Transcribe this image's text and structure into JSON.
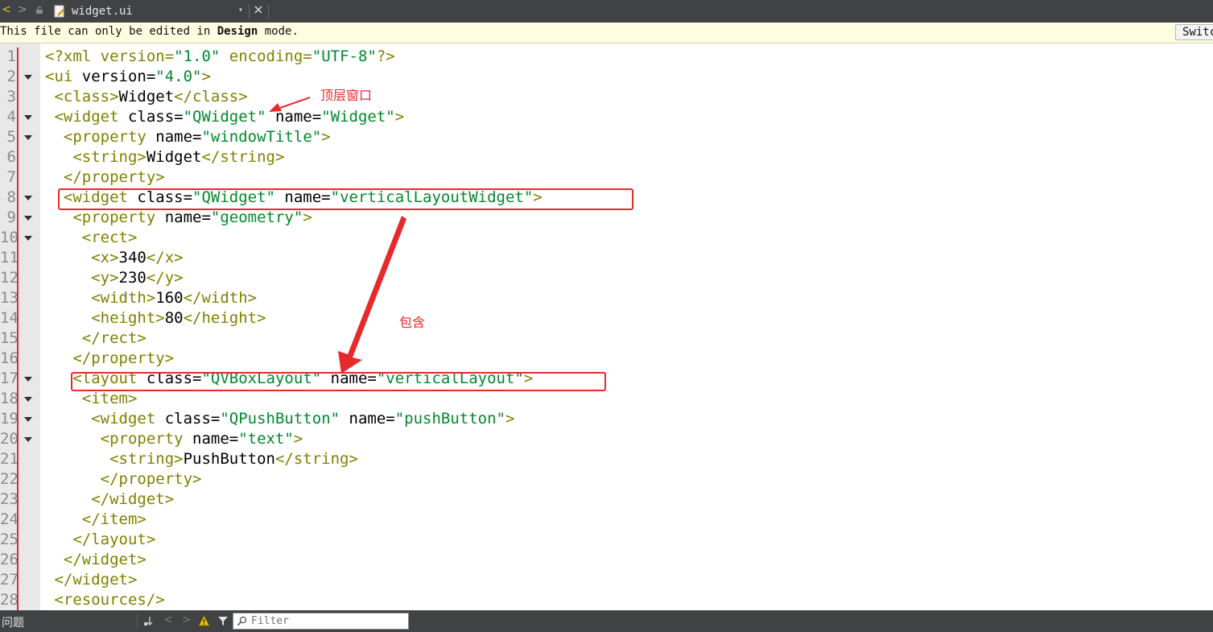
{
  "tab": {
    "back_glyph": "<",
    "forward_glyph": ">",
    "file_name": "widget.ui",
    "dropdown_glyph": "▾"
  },
  "infobar": {
    "text_before": "This file can only be edited in ",
    "text_bold": "Design",
    "text_after": " mode.",
    "switch_label": "Switch mode"
  },
  "editor": {
    "lines": [
      {
        "n": "1",
        "fold": false
      },
      {
        "n": "2",
        "fold": true
      },
      {
        "n": "3",
        "fold": false
      },
      {
        "n": "4",
        "fold": true
      },
      {
        "n": "5",
        "fold": true
      },
      {
        "n": "6",
        "fold": false
      },
      {
        "n": "7",
        "fold": false
      },
      {
        "n": "8",
        "fold": true
      },
      {
        "n": "9",
        "fold": true
      },
      {
        "n": "10",
        "fold": true
      },
      {
        "n": "11",
        "fold": false
      },
      {
        "n": "12",
        "fold": false
      },
      {
        "n": "13",
        "fold": false
      },
      {
        "n": "14",
        "fold": false
      },
      {
        "n": "15",
        "fold": false
      },
      {
        "n": "16",
        "fold": false
      },
      {
        "n": "17",
        "fold": true
      },
      {
        "n": "18",
        "fold": true
      },
      {
        "n": "19",
        "fold": true
      },
      {
        "n": "20",
        "fold": true
      },
      {
        "n": "21",
        "fold": false
      },
      {
        "n": "22",
        "fold": false
      },
      {
        "n": "23",
        "fold": false
      },
      {
        "n": "24",
        "fold": false
      },
      {
        "n": "25",
        "fold": false
      },
      {
        "n": "26",
        "fold": false
      },
      {
        "n": "27",
        "fold": false
      },
      {
        "n": "28",
        "fold": false
      }
    ],
    "code": [
      [
        [
          "t",
          "<?xml version="
        ],
        [
          "s",
          "\"1.0\""
        ],
        [
          "t",
          " encoding="
        ],
        [
          "s",
          "\"UTF-8\""
        ],
        [
          "t",
          "?>"
        ]
      ],
      [
        [
          "t",
          "<ui "
        ],
        [
          "d",
          "version="
        ],
        [
          "s",
          "\"4.0\""
        ],
        [
          "t",
          ">"
        ]
      ],
      [
        [
          "t",
          " <class>"
        ],
        [
          "d",
          "Widget"
        ],
        [
          "t",
          "</class>"
        ]
      ],
      [
        [
          "t",
          " <widget "
        ],
        [
          "d",
          "class="
        ],
        [
          "s",
          "\"QWidget\""
        ],
        [
          "d",
          " name="
        ],
        [
          "s",
          "\"Widget\""
        ],
        [
          "t",
          ">"
        ]
      ],
      [
        [
          "t",
          "  <property "
        ],
        [
          "d",
          "name="
        ],
        [
          "s",
          "\"windowTitle\""
        ],
        [
          "t",
          ">"
        ]
      ],
      [
        [
          "t",
          "   <string>"
        ],
        [
          "d",
          "Widget"
        ],
        [
          "t",
          "</string>"
        ]
      ],
      [
        [
          "t",
          "  </property>"
        ]
      ],
      [
        [
          "t",
          "  <widget "
        ],
        [
          "d",
          "class="
        ],
        [
          "s",
          "\"QWidget\""
        ],
        [
          "d",
          " name="
        ],
        [
          "s",
          "\"verticalLayoutWidget\""
        ],
        [
          "t",
          ">"
        ]
      ],
      [
        [
          "t",
          "   <property "
        ],
        [
          "d",
          "name="
        ],
        [
          "s",
          "\"geometry\""
        ],
        [
          "t",
          ">"
        ]
      ],
      [
        [
          "t",
          "    <rect>"
        ]
      ],
      [
        [
          "t",
          "     <x>"
        ],
        [
          "d",
          "340"
        ],
        [
          "t",
          "</x>"
        ]
      ],
      [
        [
          "t",
          "     <y>"
        ],
        [
          "d",
          "230"
        ],
        [
          "t",
          "</y>"
        ]
      ],
      [
        [
          "t",
          "     <width>"
        ],
        [
          "d",
          "160"
        ],
        [
          "t",
          "</width>"
        ]
      ],
      [
        [
          "t",
          "     <height>"
        ],
        [
          "d",
          "80"
        ],
        [
          "t",
          "</height>"
        ]
      ],
      [
        [
          "t",
          "    </rect>"
        ]
      ],
      [
        [
          "t",
          "   </property>"
        ]
      ],
      [
        [
          "t",
          "   <layout "
        ],
        [
          "d",
          "class="
        ],
        [
          "s",
          "\"QVBoxLayout\""
        ],
        [
          "d",
          " name="
        ],
        [
          "s",
          "\"verticalLayout\""
        ],
        [
          "t",
          ">"
        ]
      ],
      [
        [
          "t",
          "    <item>"
        ]
      ],
      [
        [
          "t",
          "     <widget "
        ],
        [
          "d",
          "class="
        ],
        [
          "s",
          "\"QPushButton\""
        ],
        [
          "d",
          " name="
        ],
        [
          "s",
          "\"pushButton\""
        ],
        [
          "t",
          ">"
        ]
      ],
      [
        [
          "t",
          "      <property "
        ],
        [
          "d",
          "name="
        ],
        [
          "s",
          "\"text\""
        ],
        [
          "t",
          ">"
        ]
      ],
      [
        [
          "t",
          "       <string>"
        ],
        [
          "d",
          "PushButton"
        ],
        [
          "t",
          "</string>"
        ]
      ],
      [
        [
          "t",
          "      </property>"
        ]
      ],
      [
        [
          "t",
          "     </widget>"
        ]
      ],
      [
        [
          "t",
          "    </item>"
        ]
      ],
      [
        [
          "t",
          "   </layout>"
        ]
      ],
      [
        [
          "t",
          "  </widget>"
        ]
      ],
      [
        [
          "t",
          " </widget>"
        ]
      ],
      [
        [
          "t",
          " <resources/>"
        ]
      ]
    ]
  },
  "annotations": {
    "top_level_window": "顶层窗口",
    "contains": "包含"
  },
  "bottom": {
    "panel_title": "问题",
    "left_glyph": "<",
    "right_glyph": ">",
    "filter_placeholder": "Filter"
  },
  "colors": {
    "tag": "#808000",
    "string": "#00892c",
    "annotation": "#e8292c",
    "chrome": "#404244"
  }
}
